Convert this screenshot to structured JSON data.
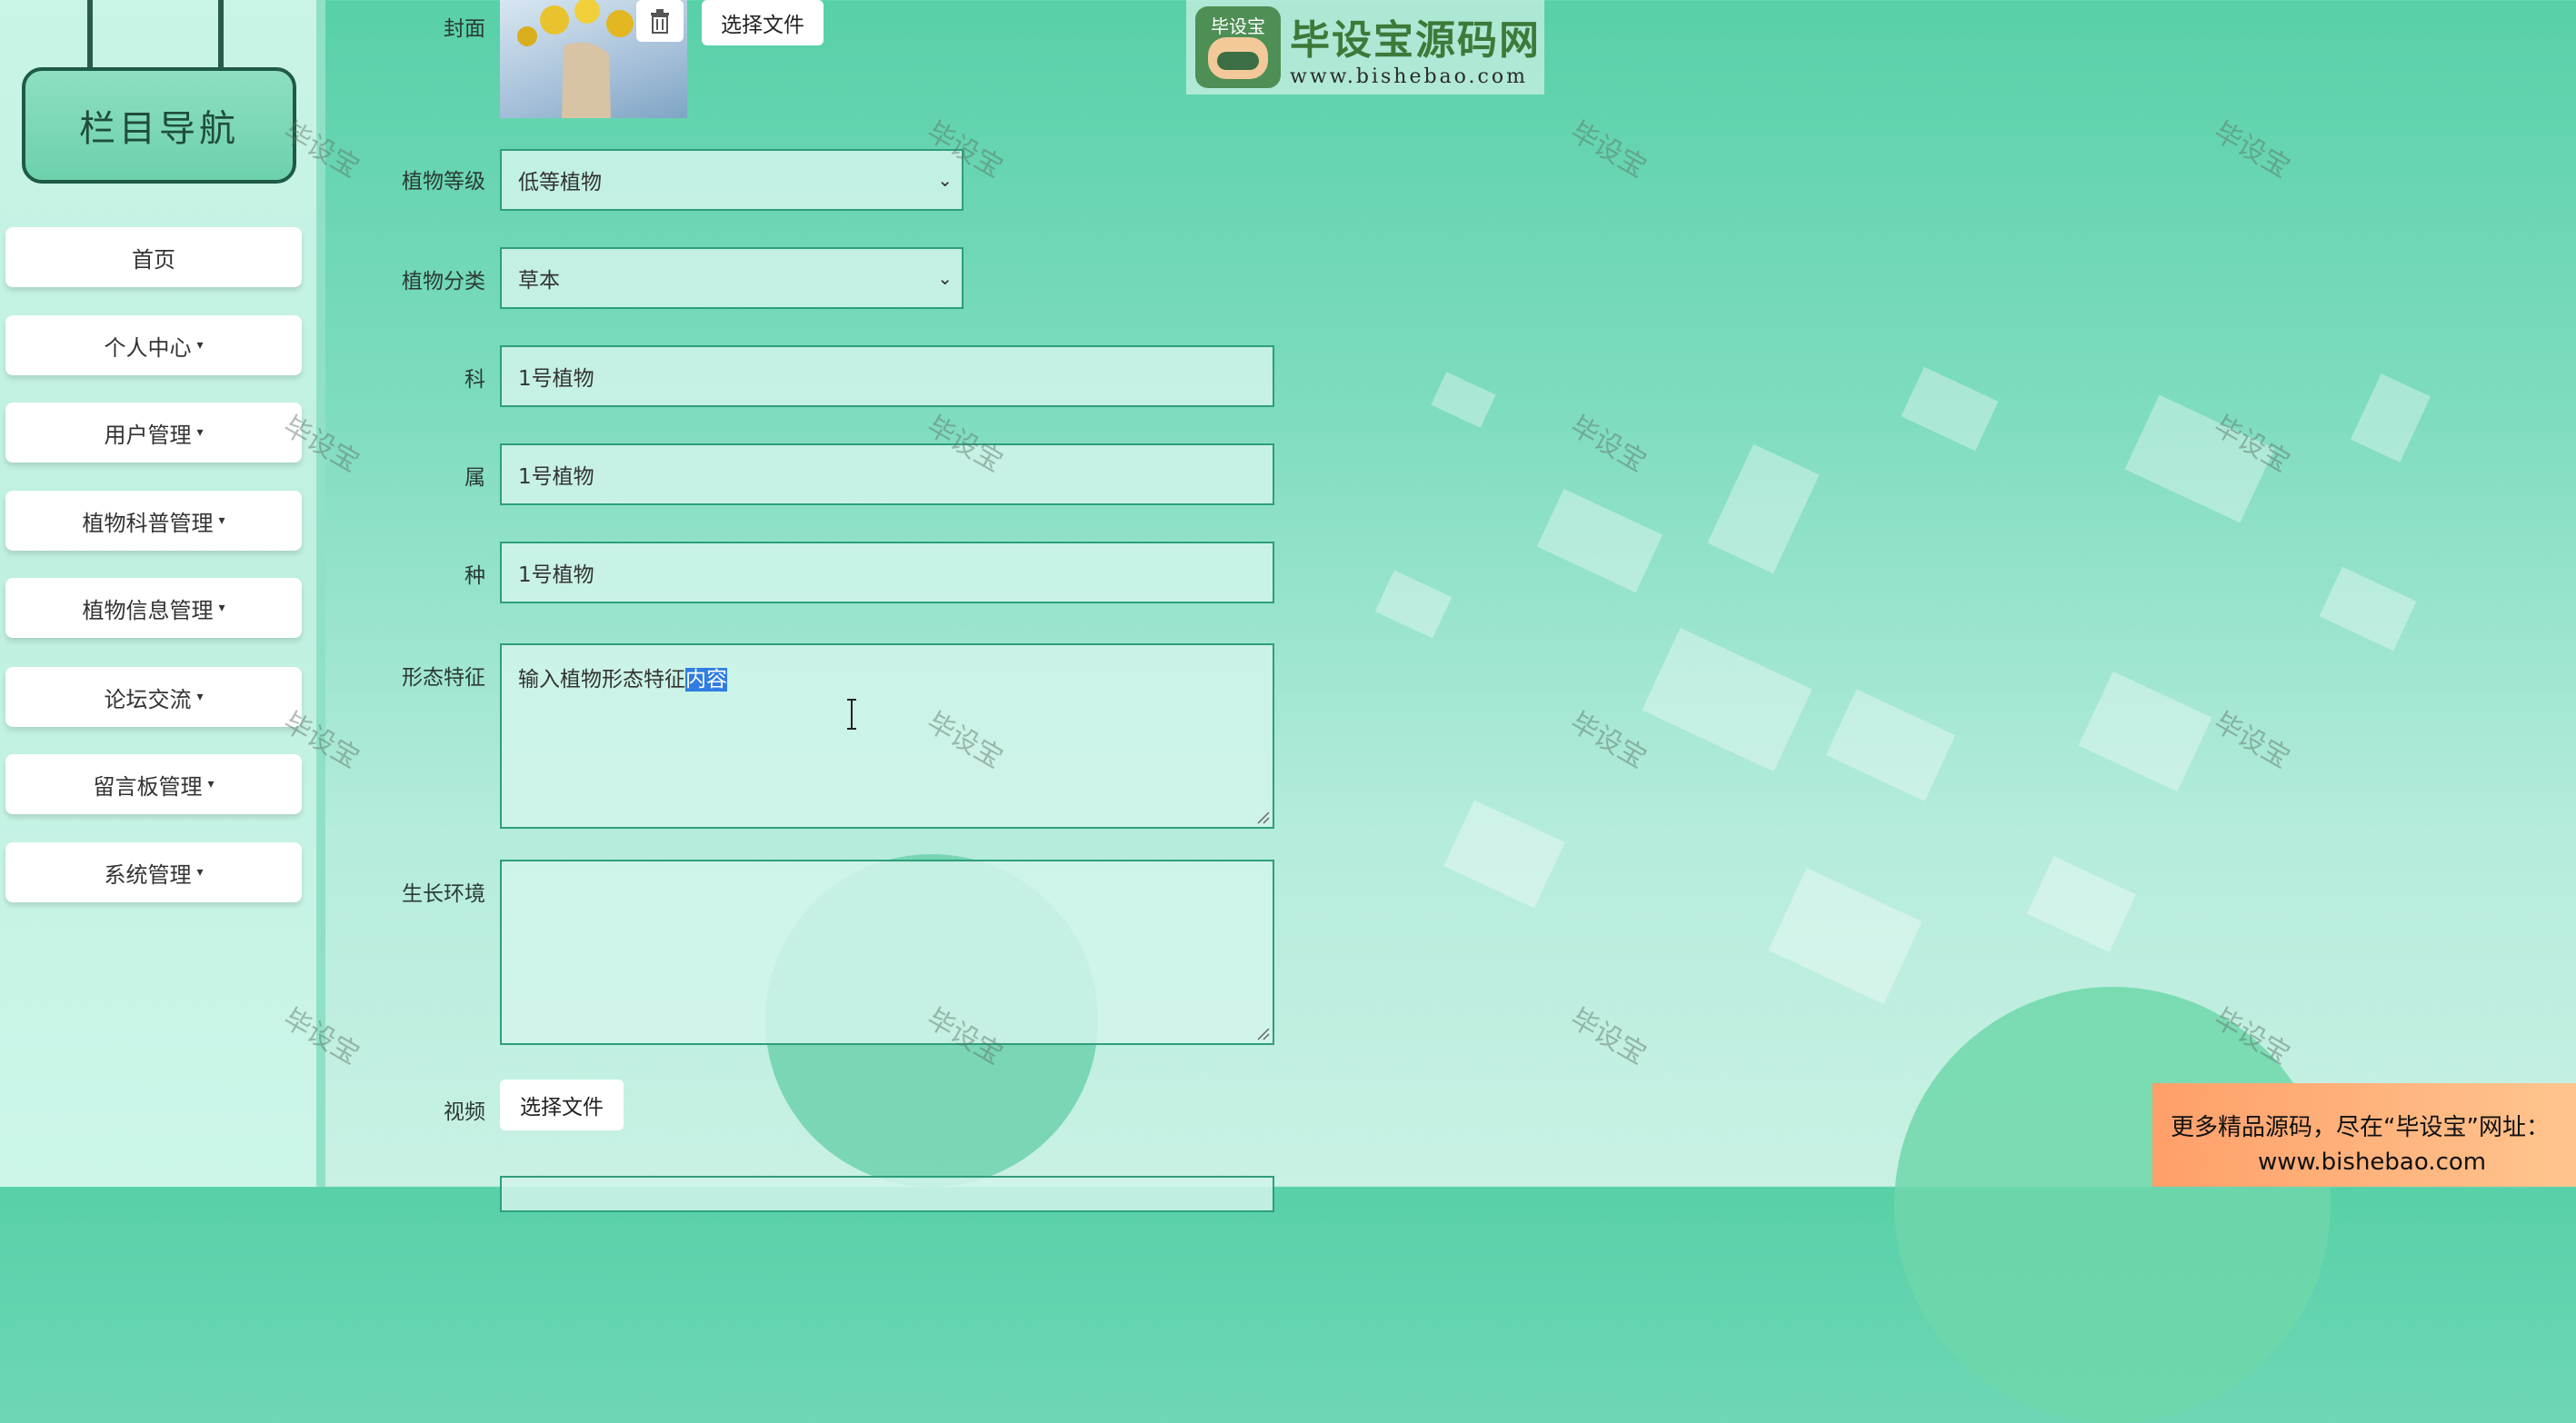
{
  "sidebar": {
    "title": "栏目导航",
    "items": [
      {
        "label": "首页",
        "caret": ""
      },
      {
        "label": "个人中心",
        "caret": "▾"
      },
      {
        "label": "用户管理",
        "caret": "▾"
      },
      {
        "label": "植物科普管理",
        "caret": "▾"
      },
      {
        "label": "植物信息管理",
        "caret": "▾"
      },
      {
        "label": "论坛交流",
        "caret": "▾"
      },
      {
        "label": "留言板管理",
        "caret": "▾"
      },
      {
        "label": "系统管理",
        "caret": "▾"
      }
    ]
  },
  "form": {
    "cover_label": "封面",
    "cover_button": "选择文件",
    "level_label": "植物等级",
    "level_value": "低等植物",
    "category_label": "植物分类",
    "category_value": "草本",
    "family_label": "科",
    "family_value": "1号植物",
    "genus_label": "属",
    "genus_value": "1号植物",
    "species_label": "种",
    "species_value": "1号植物",
    "morphology_label": "形态特征",
    "morphology_value_plain": "输入植物形态特征",
    "morphology_value_selected": "内容",
    "environment_label": "生长环境",
    "environment_value": "",
    "video_label": "视频",
    "video_button": "选择文件"
  },
  "watermark_text": "毕设宝",
  "logo": {
    "badge": "毕设宝",
    "title": "毕设宝源码网",
    "url": "www.bishebao.com"
  },
  "promo": {
    "line1": "更多精品源码，尽在“毕设宝”网址：",
    "line2": "www.bishebao.com"
  },
  "colors": {
    "accent": "#2e9e7c",
    "selection": "#2f7de1",
    "promo": "#ff9f6a"
  }
}
